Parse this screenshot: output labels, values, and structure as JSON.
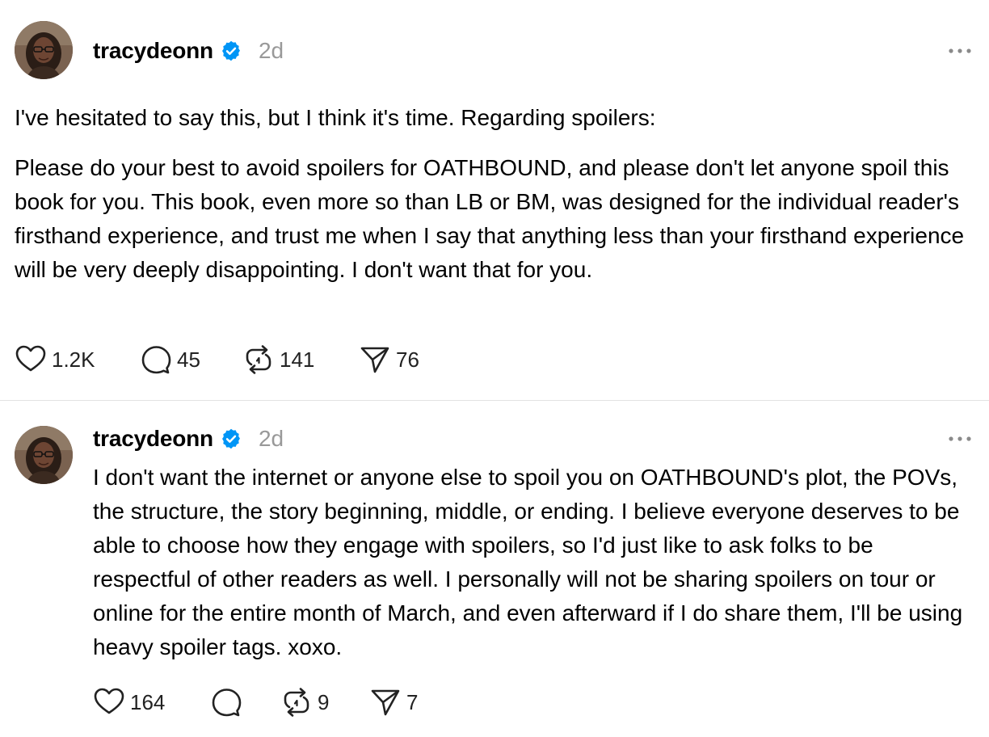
{
  "posts": [
    {
      "username": "tracydeonn",
      "time": "2d",
      "verified": true,
      "paragraphs": [
        "I've hesitated to say this, but I think it's time. Regarding spoilers:",
        "Please do your best to avoid spoilers for OATHBOUND, and please don't let anyone spoil this book for you. This book, even more so than LB or BM, was designed for the individual reader's firsthand experience, and trust me when I say that anything less than your firsthand experience will be very deeply disappointing. I don't want that for you."
      ],
      "actions": {
        "likes": "1.2K",
        "replies": "45",
        "reposts": "141",
        "shares": "76"
      }
    },
    {
      "username": "tracydeonn",
      "time": "2d",
      "verified": true,
      "paragraphs": [
        "I don't want the internet or anyone else to spoil you on OATHBOUND's plot, the POVs, the structure, the story beginning, middle, or ending. I believe everyone deserves to be able to choose how they engage with spoilers, so I'd just like to ask folks to be respectful of other readers as well. I personally will not be sharing spoilers on tour or online for the entire month of March, and even afterward if I do share them, I'll be using heavy spoiler tags. xoxo."
      ],
      "actions": {
        "likes": "164",
        "replies": "",
        "reposts": "9",
        "shares": "7"
      }
    }
  ],
  "icons": {
    "verified": "verified-badge-icon",
    "more": "more-options-icon",
    "like": "heart-icon",
    "reply": "comment-icon",
    "repost": "repost-icon",
    "share": "send-icon"
  },
  "colors": {
    "verified": "#0095f6",
    "timestamp": "#999999",
    "divider": "#e2e2e2"
  }
}
